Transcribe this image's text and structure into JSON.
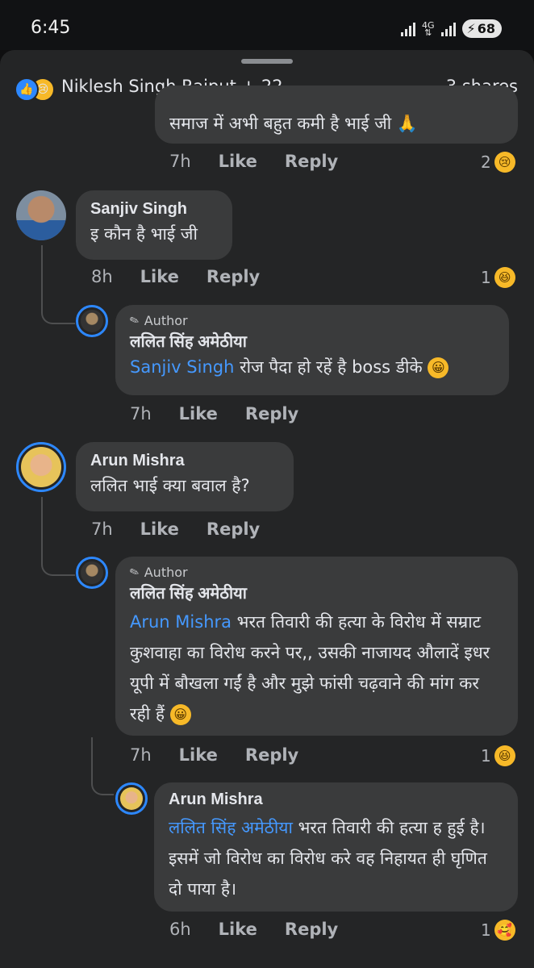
{
  "status_bar": {
    "time": "6:45",
    "network": "4G",
    "battery": "68"
  },
  "header": {
    "reactor_names": "Niklesh Singh Rajput + 22",
    "shares": "3 shares"
  },
  "comments": [
    {
      "text": "समाज में अभी बहुत कमी है भाई जी 🙏",
      "time": "7h",
      "like": "Like",
      "reply": "Reply",
      "reaction_count": "2",
      "reaction_icon": "sad-emoji-icon"
    },
    {
      "name": "Sanjiv Singh",
      "text": "इ कौन है भाई जी",
      "time": "8h",
      "like": "Like",
      "reply": "Reply",
      "reaction_count": "1",
      "reaction_icon": "haha-emoji-icon"
    },
    {
      "badge": "Author",
      "name": "ललित सिंह अमेठीया",
      "mention": "Sanjiv Singh",
      "text": " रोज पैदा हो रहें है boss डीके ",
      "time": "7h",
      "like": "Like",
      "reply": "Reply"
    },
    {
      "name": "Arun Mishra",
      "text": "ललित भाई क्या बवाल है?",
      "time": "7h",
      "like": "Like",
      "reply": "Reply"
    },
    {
      "badge": "Author",
      "name": "ललित सिंह अमेठीया",
      "mention": "Arun Mishra",
      "text": " भरत तिवारी की हत्या के विरोध में सम्राट कुशवाहा का विरोध करने पर,, उसकी नाजायद औलादें इधर यूपी में बौखला गईं है और मुझे फांसी चढ़वाने की मांग कर रही हैं ",
      "time": "7h",
      "like": "Like",
      "reply": "Reply",
      "reaction_count": "1",
      "reaction_icon": "haha-emoji-icon"
    },
    {
      "name": "Arun Mishra",
      "mention": "ललित सिंह अमेठीया",
      "text": " भरत तिवारी की हत्या ह हुई है। इसमें जो विरोध का विरोध करे वह निहायत ही घृणित दो पाया है।",
      "time": "6h",
      "like": "Like",
      "reply": "Reply",
      "reaction_count": "1",
      "reaction_icon": "care-emoji-icon"
    }
  ],
  "colors": {
    "sheet_bg": "#242526",
    "bubble_bg": "#3a3b3c",
    "mention": "#4599ff",
    "ring": "#2d88ff"
  }
}
